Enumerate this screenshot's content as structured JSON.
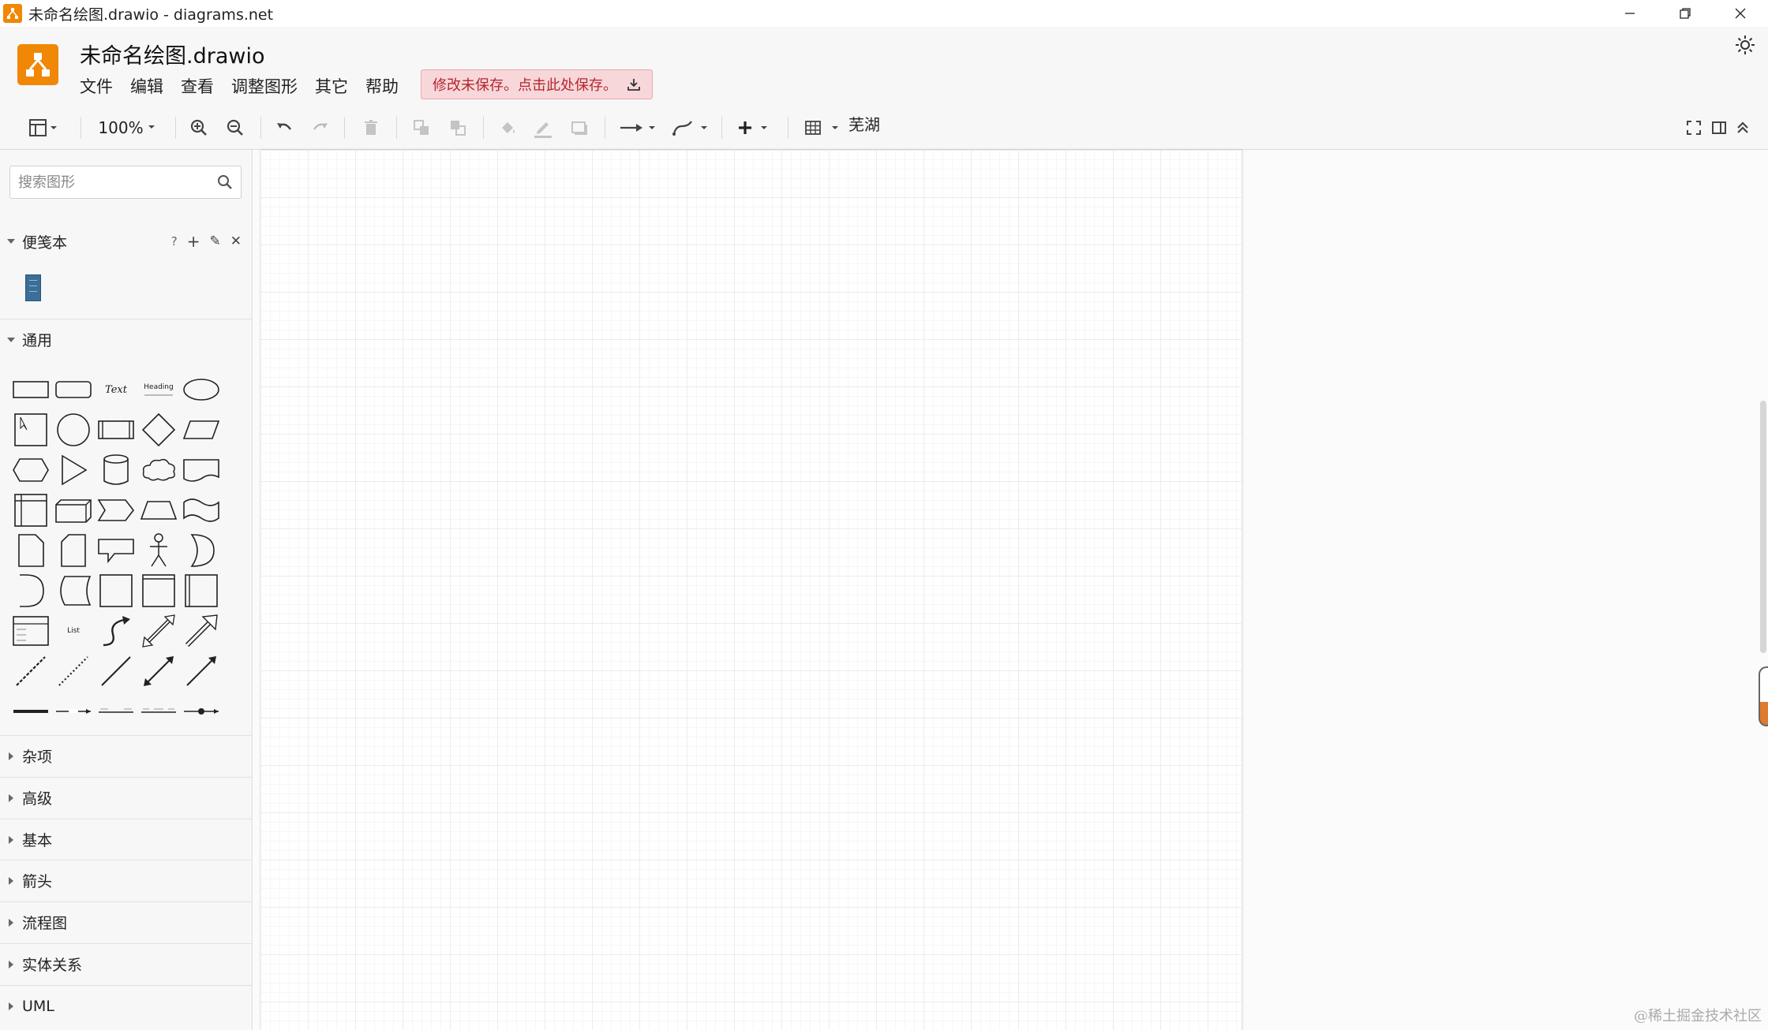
{
  "window": {
    "title": "未命名绘图.drawio - diagrams.net"
  },
  "header": {
    "doc_title": "未命名绘图.drawio",
    "menu": [
      "文件",
      "编辑",
      "查看",
      "调整图形",
      "其它",
      "帮助"
    ],
    "save_warning": "修改未保存。点击此处保存。"
  },
  "toolbar": {
    "zoom": "100%",
    "style": "芜湖"
  },
  "sidebar": {
    "search_placeholder": "搜索图形",
    "scratchpad": {
      "label": "便笺本",
      "tools": [
        "?",
        "+",
        "✎",
        "✕"
      ]
    },
    "general": {
      "label": "通用",
      "text_shape": "Text",
      "heading_shape": "Heading",
      "list_shape": "List"
    },
    "sections": [
      "杂项",
      "高级",
      "基本",
      "箭头",
      "流程图",
      "实体关系",
      "UML"
    ]
  },
  "footer": {
    "watermark": "@稀土掘金技术社区"
  },
  "colors": {
    "accent": "#f08705",
    "warning_bg": "#f8d7da",
    "warning_text": "#b3262f"
  }
}
